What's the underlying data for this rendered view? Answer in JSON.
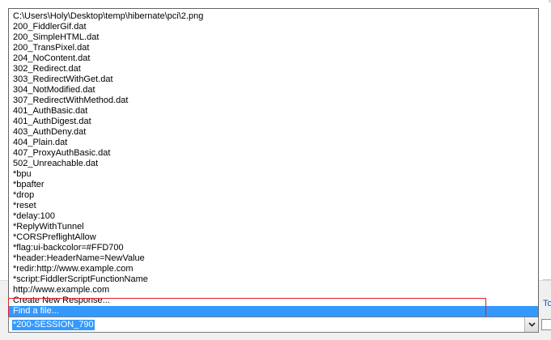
{
  "dropdown": {
    "items": [
      {
        "label": "C:\\Users\\Holy\\Desktop\\temp\\hibernate\\pci\\2.png"
      },
      {
        "label": "200_FiddlerGif.dat"
      },
      {
        "label": "200_SimpleHTML.dat"
      },
      {
        "label": "200_TransPixel.dat"
      },
      {
        "label": "204_NoContent.dat"
      },
      {
        "label": "302_Redirect.dat"
      },
      {
        "label": "303_RedirectWithGet.dat"
      },
      {
        "label": "304_NotModified.dat"
      },
      {
        "label": "307_RedirectWithMethod.dat"
      },
      {
        "label": "401_AuthBasic.dat"
      },
      {
        "label": "401_AuthDigest.dat"
      },
      {
        "label": "403_AuthDeny.dat"
      },
      {
        "label": "404_Plain.dat"
      },
      {
        "label": "407_ProxyAuthBasic.dat"
      },
      {
        "label": "502_Unreachable.dat"
      },
      {
        "label": "*bpu"
      },
      {
        "label": "*bpafter"
      },
      {
        "label": "*drop"
      },
      {
        "label": "*reset"
      },
      {
        "label": "*delay:100"
      },
      {
        "label": "*ReplyWithTunnel"
      },
      {
        "label": "*CORSPreflightAllow"
      },
      {
        "label": "*flag:ui-backcolor=#FFD700"
      },
      {
        "label": "*header:HeaderName=NewValue"
      },
      {
        "label": "*redir:http://www.example.com"
      },
      {
        "label": "*script:FiddlerScriptFunctionName"
      },
      {
        "label": "http://www.example.com"
      },
      {
        "label": "Create New Response..."
      },
      {
        "label": "Find a file..."
      }
    ],
    "selected_label": "Find a file..."
  },
  "combo": {
    "value": "*200-SESSION_790",
    "button_icon": "chevron-down-icon"
  },
  "background": {
    "right_label": "To"
  },
  "colors": {
    "selection": "#3399ff",
    "highlight_border": "#e02020"
  }
}
